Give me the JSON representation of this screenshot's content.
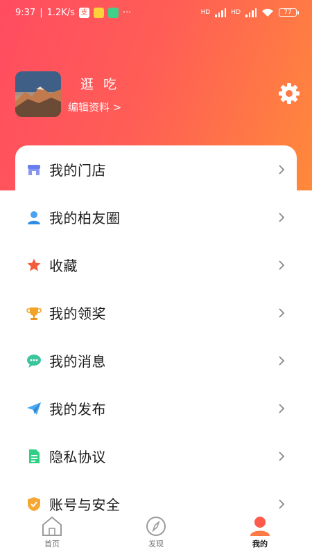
{
  "status_bar": {
    "time": "9:37",
    "speed": "1.2K/s",
    "dots": "···",
    "battery": "77",
    "hd_label": "HD"
  },
  "profile": {
    "name": "逛 吃",
    "edit_label": "编辑资料 >"
  },
  "menu": {
    "items": [
      {
        "label": "我的门店",
        "icon": "store-icon",
        "color": "#6a7ef0"
      },
      {
        "label": "我的柏友圈",
        "icon": "person-icon",
        "color": "#4aa3f2"
      },
      {
        "label": "收藏",
        "icon": "star-icon",
        "color": "#f45b3d"
      },
      {
        "label": "我的领奖",
        "icon": "trophy-icon",
        "color": "#f2a429"
      },
      {
        "label": "我的消息",
        "icon": "chat-bubble-icon",
        "color": "#3cc59d"
      },
      {
        "label": "我的发布",
        "icon": "paper-plane-icon",
        "color": "#4aa8f0"
      },
      {
        "label": "隐私协议",
        "icon": "document-icon",
        "color": "#2fcf86"
      },
      {
        "label": "账号与安全",
        "icon": "shield-icon",
        "color": "#f6a733"
      }
    ]
  },
  "tabbar": {
    "tabs": [
      {
        "label": "首页",
        "icon": "home-icon"
      },
      {
        "label": "发现",
        "icon": "compass-icon"
      },
      {
        "label": "我的",
        "icon": "user-icon",
        "active": true
      }
    ]
  },
  "colors": {
    "header_start": "#ff4c61",
    "header_end": "#ff8a3a",
    "active_tab": "#ff5a4c"
  }
}
